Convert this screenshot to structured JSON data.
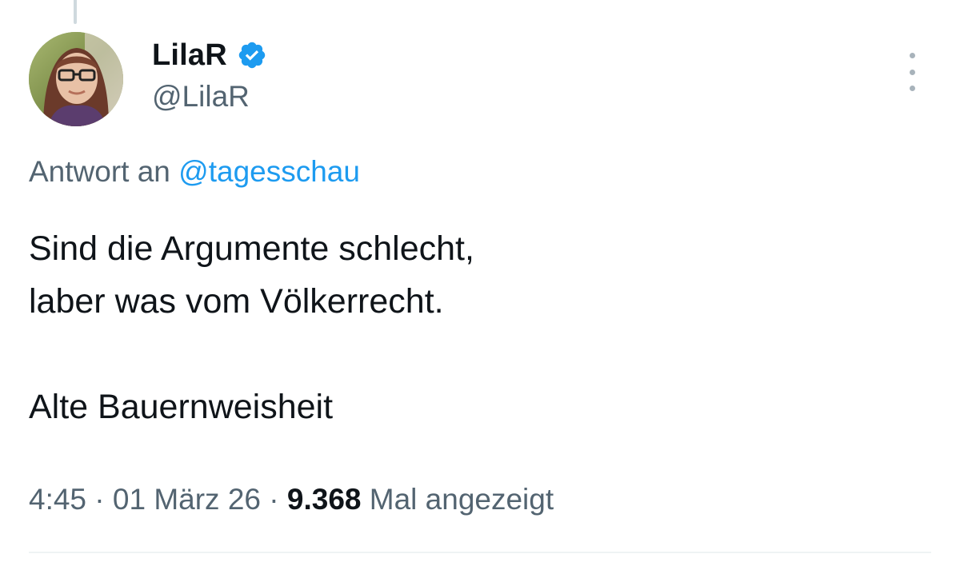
{
  "author": {
    "display_name": "LilaR",
    "handle": "@LilaR",
    "verified": true,
    "verified_color": "#1d9bf0"
  },
  "reply": {
    "prefix": "Antwort an",
    "mention": "@tagesschau",
    "mention_color": "#1d9bf0"
  },
  "tweet": {
    "lines": [
      "Sind die Argumente schlecht,",
      "laber was vom Völkerrecht.",
      "",
      "Alte Bauernweisheit"
    ]
  },
  "meta": {
    "time": "4:45",
    "separator": "·",
    "date": "01 März 26",
    "views_count": "9.368",
    "views_label": "Mal angezeigt"
  },
  "icons": {
    "more": "more-vertical-icon",
    "verified": "verified-badge-icon"
  }
}
